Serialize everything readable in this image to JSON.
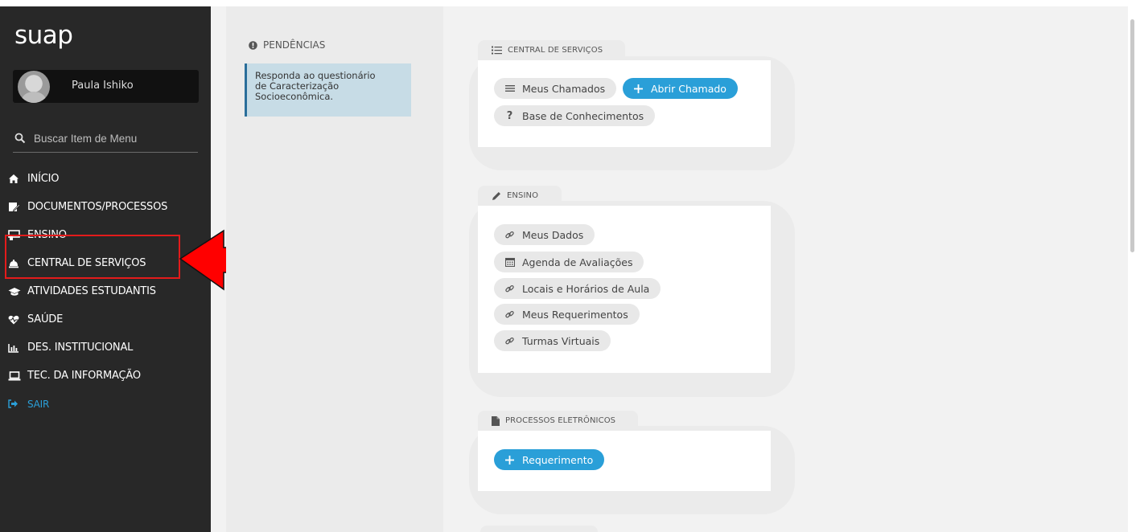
{
  "sidebar": {
    "logo": "suap",
    "user_name": "Paula Ishiko",
    "search_placeholder": "Buscar Item de Menu",
    "menu": [
      {
        "label": "INÍCIO",
        "icon": "home-icon"
      },
      {
        "label": "DOCUMENTOS/PROCESSOS",
        "icon": "document-edit-icon"
      },
      {
        "label": "ENSINO",
        "icon": "classroom-icon"
      },
      {
        "label": "CENTRAL DE SERVIÇOS",
        "icon": "bell-icon"
      },
      {
        "label": "ATIVIDADES ESTUDANTIS",
        "icon": "graduation-cap-icon"
      },
      {
        "label": "SAÚDE",
        "icon": "heartbeat-icon"
      },
      {
        "label": "DES. INSTITUCIONAL",
        "icon": "bar-chart-icon"
      },
      {
        "label": "TEC. DA INFORMAÇÃO",
        "icon": "laptop-icon"
      },
      {
        "label": "SAIR",
        "icon": "sign-out-icon"
      }
    ]
  },
  "pendencias": {
    "title": "PENDÊNCIAS",
    "card_lines": [
      "Responda ao questionário",
      "de Caracterização",
      "Socioeconômica."
    ]
  },
  "panels": {
    "central": {
      "title": "CENTRAL DE SERVIÇOS",
      "links": {
        "meus_chamados": "Meus Chamados",
        "abrir_chamado": "Abrir Chamado",
        "base": "Base de Conhecimentos"
      }
    },
    "ensino": {
      "title": "ENSINO",
      "links": [
        "Meus Dados",
        "Agenda de Avaliações",
        "Locais e Horários de Aula",
        "Meus Requerimentos",
        "Turmas Virtuais"
      ]
    },
    "processos": {
      "title": "PROCESSOS ELETRÔNICOS",
      "links": {
        "requerimento": "Requerimento"
      }
    }
  },
  "colors": {
    "sidebar_bg": "#282828",
    "accent_blue": "#2a9fd8",
    "highlight_red": "#e31b1b",
    "pending_card_bg": "#c7dce6"
  }
}
